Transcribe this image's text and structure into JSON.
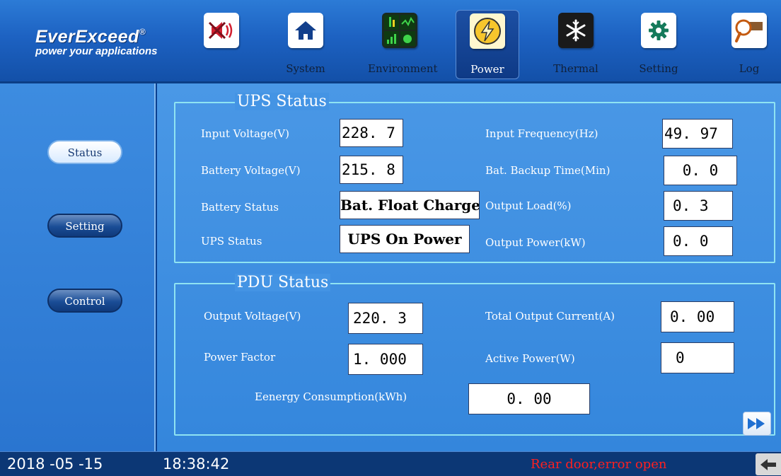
{
  "brand": {
    "name": "EverExceed",
    "registered": "®",
    "tagline": "power your applications"
  },
  "nav": {
    "items": [
      {
        "label": "",
        "icon": "mute-alarm-icon"
      },
      {
        "label": "System",
        "icon": "home-icon"
      },
      {
        "label": "Environment",
        "icon": "environment-grid-icon"
      },
      {
        "label": "Power",
        "icon": "lightning-icon"
      },
      {
        "label": "Thermal",
        "icon": "snowflake-icon"
      },
      {
        "label": "Setting",
        "icon": "gear-icon"
      },
      {
        "label": "Log",
        "icon": "magnifier-icon"
      }
    ],
    "active": "Power"
  },
  "sidebar": {
    "items": [
      {
        "label": "Status",
        "selected": true
      },
      {
        "label": "Setting",
        "selected": false
      },
      {
        "label": "Control",
        "selected": false
      }
    ]
  },
  "ups": {
    "title": "UPS Status",
    "input_voltage": {
      "label": "Input Voltage(V)",
      "value": "228. 7"
    },
    "battery_voltage": {
      "label": "Battery Voltage(V)",
      "value": "215. 8"
    },
    "battery_status": {
      "label": "Battery Status",
      "value": "Bat. Float Charge"
    },
    "ups_status": {
      "label": "UPS Status",
      "value": "UPS On Power"
    },
    "input_frequency": {
      "label": "Input Frequency(Hz)",
      "value": "49. 97"
    },
    "backup_time": {
      "label": "Bat. Backup Time(Min)",
      "value": "0. 0"
    },
    "output_load": {
      "label": "Output Load(%)",
      "value": "0. 3"
    },
    "output_power": {
      "label": "Output Power(kW)",
      "value": "0. 0"
    }
  },
  "pdu": {
    "title": "PDU Status",
    "output_voltage": {
      "label": "Output Voltage(V)",
      "value": "220. 3"
    },
    "power_factor": {
      "label": "Power Factor",
      "value": "1. 000"
    },
    "total_current": {
      "label": "Total Output Current(A)",
      "value": "0. 00"
    },
    "active_power": {
      "label": "Active Power(W)",
      "value": "0"
    },
    "energy": {
      "label": "Eenergy Consumption(kWh)",
      "value": "0. 00"
    }
  },
  "status_bar": {
    "date": "2018 -05 -15",
    "time": "18:38:42",
    "alarm": "Rear door,error open"
  },
  "colors": {
    "accent": "#3486dc",
    "alarm": "#ff2020",
    "frame": "#8fe3f2"
  }
}
